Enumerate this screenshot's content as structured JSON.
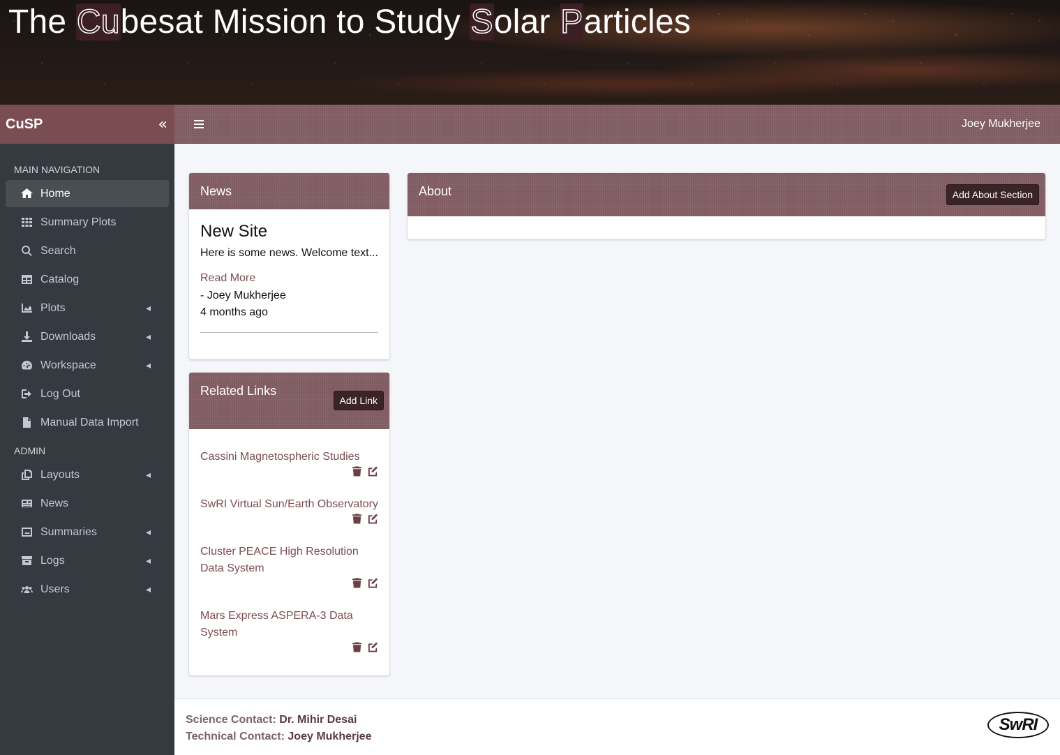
{
  "banner": {
    "title_parts": [
      {
        "text": "The ",
        "highlight": false
      },
      {
        "text": "Cu",
        "highlight": true
      },
      {
        "text": "besat Mission to Study ",
        "highlight": false
      },
      {
        "text": "S",
        "highlight": true
      },
      {
        "text": "olar ",
        "highlight": false
      },
      {
        "text": "P",
        "highlight": true
      },
      {
        "text": "articles",
        "highlight": false
      }
    ]
  },
  "brand": {
    "name": "CuSP",
    "collapse_icon": "double-chevron-left-icon"
  },
  "topbar": {
    "user": "Joey Mukherjee",
    "menu_icon": "hamburger-icon"
  },
  "sidebar": {
    "main_header": "MAIN NAVIGATION",
    "main_items": [
      {
        "label": "Home",
        "icon": "home-icon",
        "active": true,
        "has_caret": false
      },
      {
        "label": "Summary Plots",
        "icon": "grid-icon",
        "active": false,
        "has_caret": false
      },
      {
        "label": "Search",
        "icon": "search-icon",
        "active": false,
        "has_caret": false
      },
      {
        "label": "Catalog",
        "icon": "table-icon",
        "active": false,
        "has_caret": false
      },
      {
        "label": "Plots",
        "icon": "area-chart-icon",
        "active": false,
        "has_caret": true
      },
      {
        "label": "Downloads",
        "icon": "download-icon",
        "active": false,
        "has_caret": true
      },
      {
        "label": "Workspace",
        "icon": "gauge-icon",
        "active": false,
        "has_caret": true
      },
      {
        "label": "Log Out",
        "icon": "sign-out-icon",
        "active": false,
        "has_caret": false
      },
      {
        "label": "Manual Data Import",
        "icon": "file-icon",
        "active": false,
        "has_caret": false
      }
    ],
    "admin_header": "ADMIN",
    "admin_items": [
      {
        "label": "Layouts",
        "icon": "copy-icon",
        "active": false,
        "has_caret": true
      },
      {
        "label": "News",
        "icon": "newspaper-icon",
        "active": false,
        "has_caret": false
      },
      {
        "label": "Summaries",
        "icon": "image-icon",
        "active": false,
        "has_caret": true
      },
      {
        "label": "Logs",
        "icon": "archive-icon",
        "active": false,
        "has_caret": true
      },
      {
        "label": "Users",
        "icon": "users-icon",
        "active": false,
        "has_caret": true
      }
    ]
  },
  "news": {
    "title": "News",
    "headline": "New Site",
    "text": "Here is some news. Welcome text...",
    "read_more": "Read More",
    "author": "- Joey Mukherjee",
    "time": "4 months ago"
  },
  "related_links": {
    "title": "Related Links",
    "add_label": "Add Link",
    "items": [
      {
        "label": "Cassini Magnetospheric Studies"
      },
      {
        "label": "SwRI Virtual Sun/Earth Observatory"
      },
      {
        "label": "Cluster PEACE High Resolution Data System"
      },
      {
        "label": "Mars Express ASPERA-3 Data System"
      }
    ]
  },
  "about": {
    "title": "About",
    "add_label": "Add About Section"
  },
  "footer": {
    "science_label": "Science Contact:",
    "science_value": "Dr. Mihir Desai",
    "technical_label": "Technical Contact:",
    "technical_value": "Joey Mukherjee",
    "logo_text": "SwRI"
  },
  "colors": {
    "header_maroon": "#7e5a60",
    "sidebar_bg": "#343a40",
    "link_color": "#7a4d52",
    "button_dark": "#3a2427"
  }
}
